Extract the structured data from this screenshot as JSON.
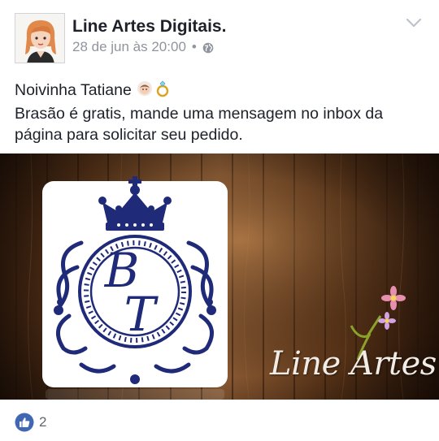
{
  "post": {
    "author": "Line Artes Digitais.",
    "timestamp": "28 de jun às 20:00",
    "separator": "•",
    "privacy_icon": "globe-icon",
    "menu_icon": "chevron-down-icon",
    "text_line1": "Noivinha Tatiane",
    "text_line2": "Brasão é gratis, mande uma mensagem no inbox da",
    "text_line3": "página para solicitar seu pedido.",
    "emojis": [
      "bride-emoji",
      "ring-emoji"
    ]
  },
  "image": {
    "monogram_top": "B",
    "monogram_bottom": "T",
    "watermark": "Line Artes",
    "colors": {
      "wood_dark": "#3b2212",
      "wood_light": "#7a4b2a",
      "crest_navy": "#1f2a78",
      "card_bg": "#ffffff",
      "flower_pink": "#e88fb0"
    }
  },
  "reactions": {
    "icon": "like-icon",
    "count": "2",
    "color": "#4267b2"
  }
}
